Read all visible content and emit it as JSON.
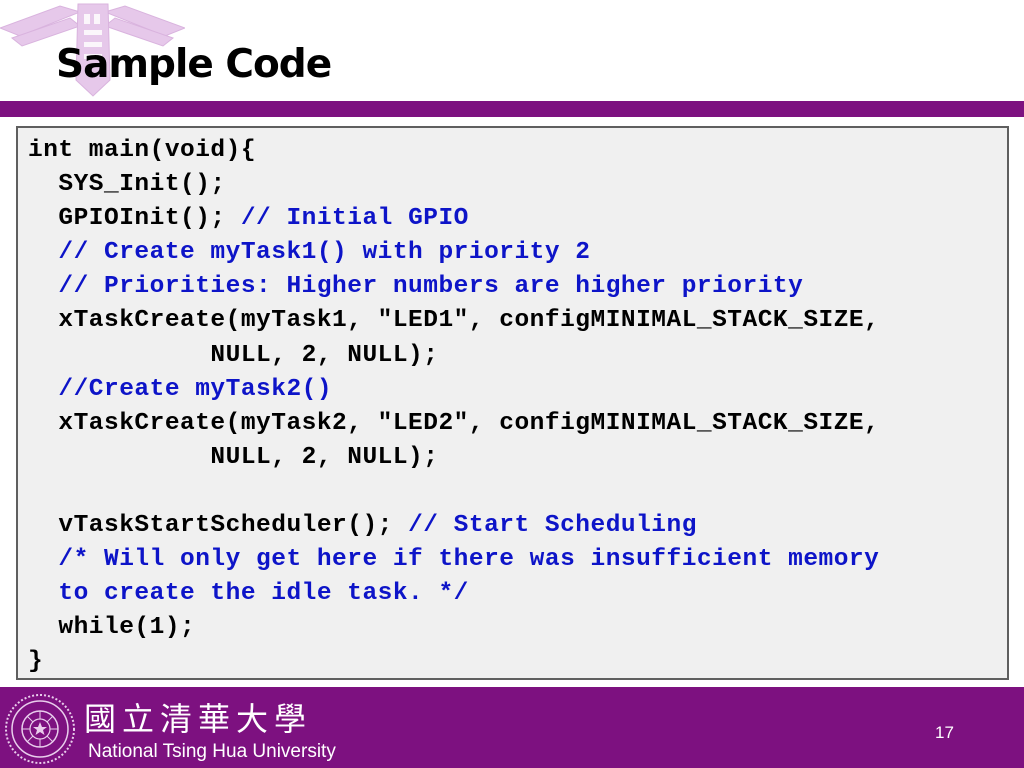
{
  "slide": {
    "title": "Sample Code",
    "page_number": "17"
  },
  "code": {
    "lines": [
      [
        {
          "t": "int main(void){",
          "c": false
        }
      ],
      [
        {
          "t": "  SYS_Init();",
          "c": false
        }
      ],
      [
        {
          "t": "  GPIOInit(); ",
          "c": false
        },
        {
          "t": "// Initial GPIO",
          "c": true
        }
      ],
      [
        {
          "t": "  // Create myTask1() with priority 2",
          "c": true
        }
      ],
      [
        {
          "t": "  // Priorities: Higher numbers are higher priority",
          "c": true
        }
      ],
      [
        {
          "t": "  xTaskCreate(myTask1, \"LED1\", configMINIMAL_STACK_SIZE,",
          "c": false
        }
      ],
      [
        {
          "t": "            NULL, 2, NULL);",
          "c": false
        }
      ],
      [
        {
          "t": "  //Create myTask2()",
          "c": true
        }
      ],
      [
        {
          "t": "  xTaskCreate(myTask2, \"LED2\", configMINIMAL_STACK_SIZE,",
          "c": false
        }
      ],
      [
        {
          "t": "            NULL, 2, NULL);",
          "c": false
        }
      ],
      [
        {
          "t": "",
          "c": false
        }
      ],
      [
        {
          "t": "  vTaskStartScheduler(); ",
          "c": false
        },
        {
          "t": "// Start Scheduling",
          "c": true
        }
      ],
      [
        {
          "t": "  /* Will only get here if there was insufficient memory",
          "c": true
        }
      ],
      [
        {
          "t": "  to create the idle task. */",
          "c": true
        }
      ],
      [
        {
          "t": "  while(1);",
          "c": false
        }
      ],
      [
        {
          "t": "}",
          "c": false
        }
      ]
    ],
    "comment_color": "#0d14c8",
    "code_color": "#000000"
  },
  "footer": {
    "university_zh": "國立清華大學",
    "university_en": "National Tsing Hua University",
    "seal_icon": "university-seal-icon"
  },
  "colors": {
    "brand_purple": "#7d1180",
    "code_background": "#f0f0f0"
  }
}
